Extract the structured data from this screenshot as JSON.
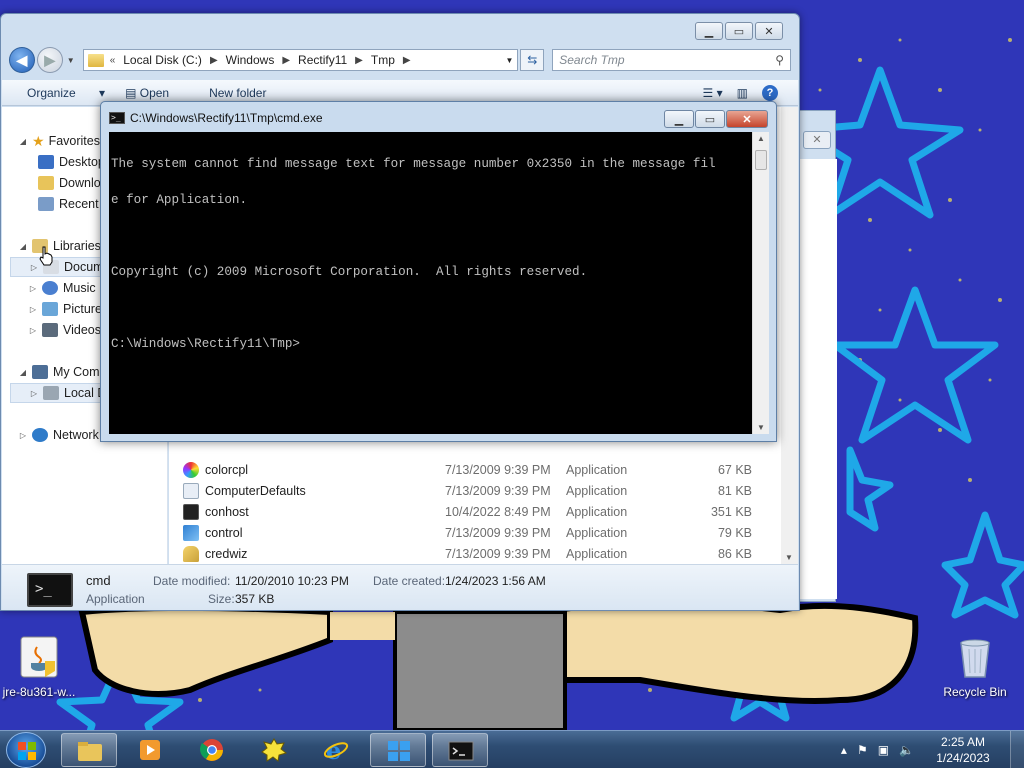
{
  "desktop": {
    "icons": [
      {
        "label": "jre-8u361-w...",
        "icon": "java-installer-icon"
      },
      {
        "label": "Recycle Bin",
        "icon": "recycle-bin-icon"
      }
    ]
  },
  "explorer": {
    "address": {
      "crumbs": [
        "Local Disk (C:)",
        "Windows",
        "Rectify11",
        "Tmp"
      ],
      "overflow": "«"
    },
    "search_placeholder": "Search Tmp",
    "toolbar": {
      "organize": "Organize",
      "open": "Open",
      "new_folder": "New folder"
    },
    "nav": {
      "favorites": "Favorites",
      "desktop": "Desktop",
      "downloads": "Downlo",
      "recent": "Recent",
      "libraries": "Libraries",
      "documents": "Docume",
      "music": "Music",
      "pictures": "Pictures",
      "videos": "Videos",
      "computer": "My Comp",
      "local_disk": "Local Di",
      "network": "Network"
    },
    "files": [
      {
        "name": "colorcpl",
        "date": "7/13/2009 9:39 PM",
        "type": "Application",
        "size": "67 KB",
        "icon": "color-icon"
      },
      {
        "name": "ComputerDefaults",
        "date": "7/13/2009 9:39 PM",
        "type": "Application",
        "size": "81 KB",
        "icon": "app-icon"
      },
      {
        "name": "conhost",
        "date": "10/4/2022 8:49 PM",
        "type": "Application",
        "size": "351 KB",
        "icon": "console-icon"
      },
      {
        "name": "control",
        "date": "7/13/2009 9:39 PM",
        "type": "Application",
        "size": "79 KB",
        "icon": "control-panel-icon"
      },
      {
        "name": "credwiz",
        "date": "7/13/2009 9:39 PM",
        "type": "Application",
        "size": "86 KB",
        "icon": "key-icon"
      }
    ],
    "details": {
      "name": "cmd",
      "type": "Application",
      "modified_label": "Date modified:",
      "modified": "11/20/2010 10:23 PM",
      "created_label": "Date created:",
      "created": "1/24/2023 1:56 AM",
      "size_label": "Size:",
      "size": "357 KB"
    }
  },
  "cmd": {
    "title": "C:\\Windows\\Rectify11\\Tmp\\cmd.exe",
    "lines": [
      "The system cannot find message text for message number 0x2350 in the message fil",
      "e for Application.",
      "",
      "Copyright (c) 2009 Microsoft Corporation.  All rights reserved.",
      "",
      "C:\\Windows\\Rectify11\\Tmp>"
    ]
  },
  "taskbar": {
    "time": "2:25 AM",
    "date": "1/24/2023",
    "apps": [
      "explorer",
      "media-player",
      "chrome",
      "bin-app",
      "internet-explorer",
      "start-menu-app",
      "cmd"
    ]
  },
  "colors": {
    "wallpaper": "#2f36b8",
    "console_bg": "#000000",
    "console_fg": "#c0c0c0"
  }
}
